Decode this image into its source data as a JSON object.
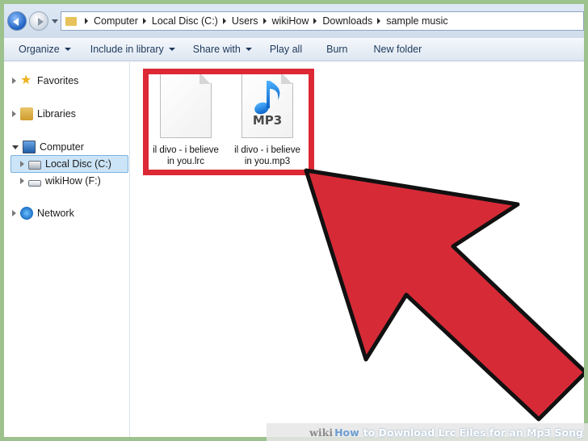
{
  "address_bar": {
    "crumbs": [
      "Computer",
      "Local Disc (C:)",
      "Users",
      "wikiHow",
      "Downloads",
      "sample music"
    ]
  },
  "toolbar": {
    "organize": "Organize",
    "include_in_library": "Include in library",
    "share_with": "Share with",
    "play_all": "Play all",
    "burn": "Burn",
    "new_folder": "New folder"
  },
  "navpane": {
    "favorites": "Favorites",
    "libraries": "Libraries",
    "computer": "Computer",
    "local_disc": "Local Disc (C:)",
    "wikihow_drive": "wikiHow (F:)",
    "network": "Network"
  },
  "files": [
    {
      "name_line1": "il divo - i believe",
      "name_line2": "in you.lrc",
      "type": "lrc"
    },
    {
      "name_line1": "il divo - i believe",
      "name_line2": "in you.mp3",
      "type": "mp3",
      "badge": "MP3"
    }
  ],
  "footer": {
    "wiki": "wiki",
    "how": "How",
    "title": "to Download Lrc Files for an Mp3 Song"
  },
  "colors": {
    "highlight": "#dc2935",
    "arrow": "#d72a37",
    "border": "#9dc28e",
    "selection": "#cce4f7"
  }
}
